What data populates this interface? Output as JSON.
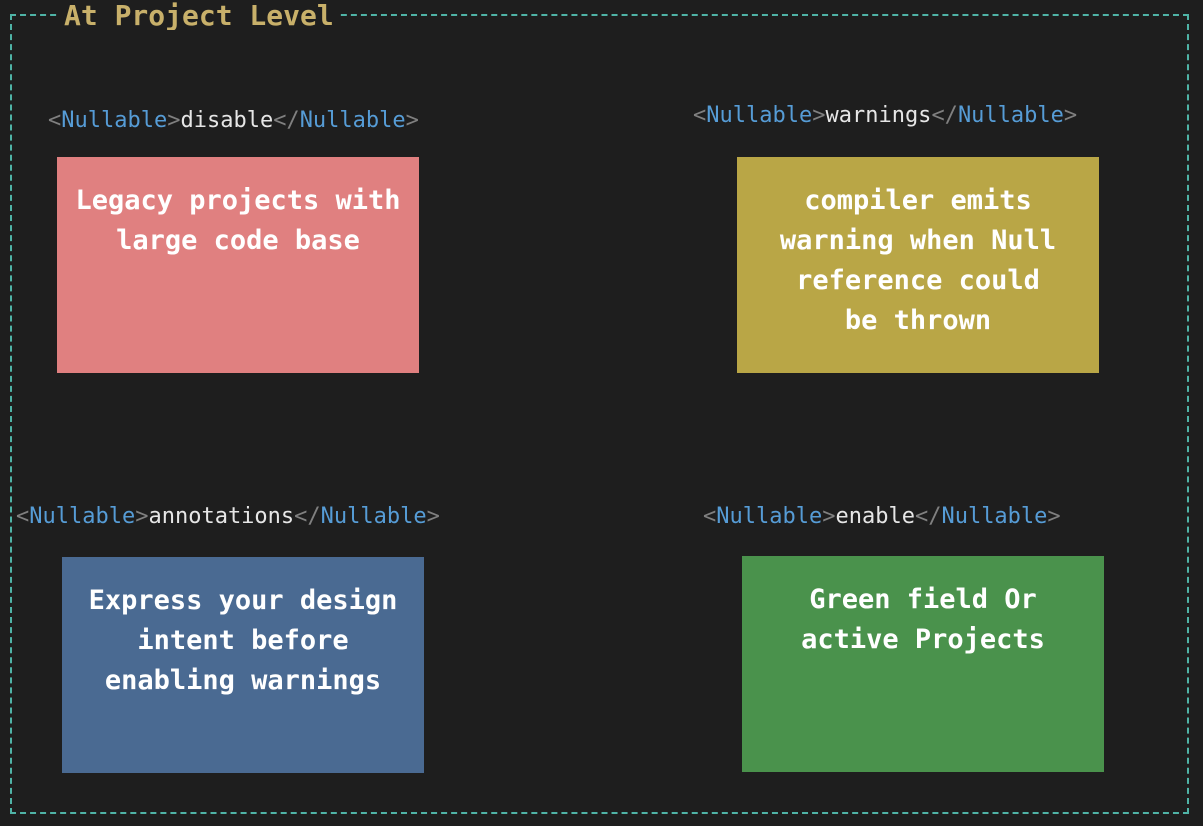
{
  "frame": {
    "title": "At Project Level",
    "border_color": "#4fb3a6",
    "title_color": "#c8b06a"
  },
  "tag": {
    "name": "Nullable",
    "name_color": "#569cd6",
    "bracket_color": "#808080"
  },
  "quadrants": [
    {
      "id": "disable",
      "setting": "disable",
      "description": "Legacy projects with\nlarge code base",
      "color": "#e08080"
    },
    {
      "id": "warnings",
      "setting": "warnings",
      "description": "compiler emits\nwarning when Null\nreference could\nbe thrown",
      "color": "#b9a646"
    },
    {
      "id": "annotations",
      "setting": "annotations",
      "description": "Express your design\nintent before\nenabling warnings",
      "color": "#4a6a92"
    },
    {
      "id": "enable",
      "setting": "enable",
      "description": "Green field Or\nactive Projects",
      "color": "#4a924c"
    }
  ]
}
